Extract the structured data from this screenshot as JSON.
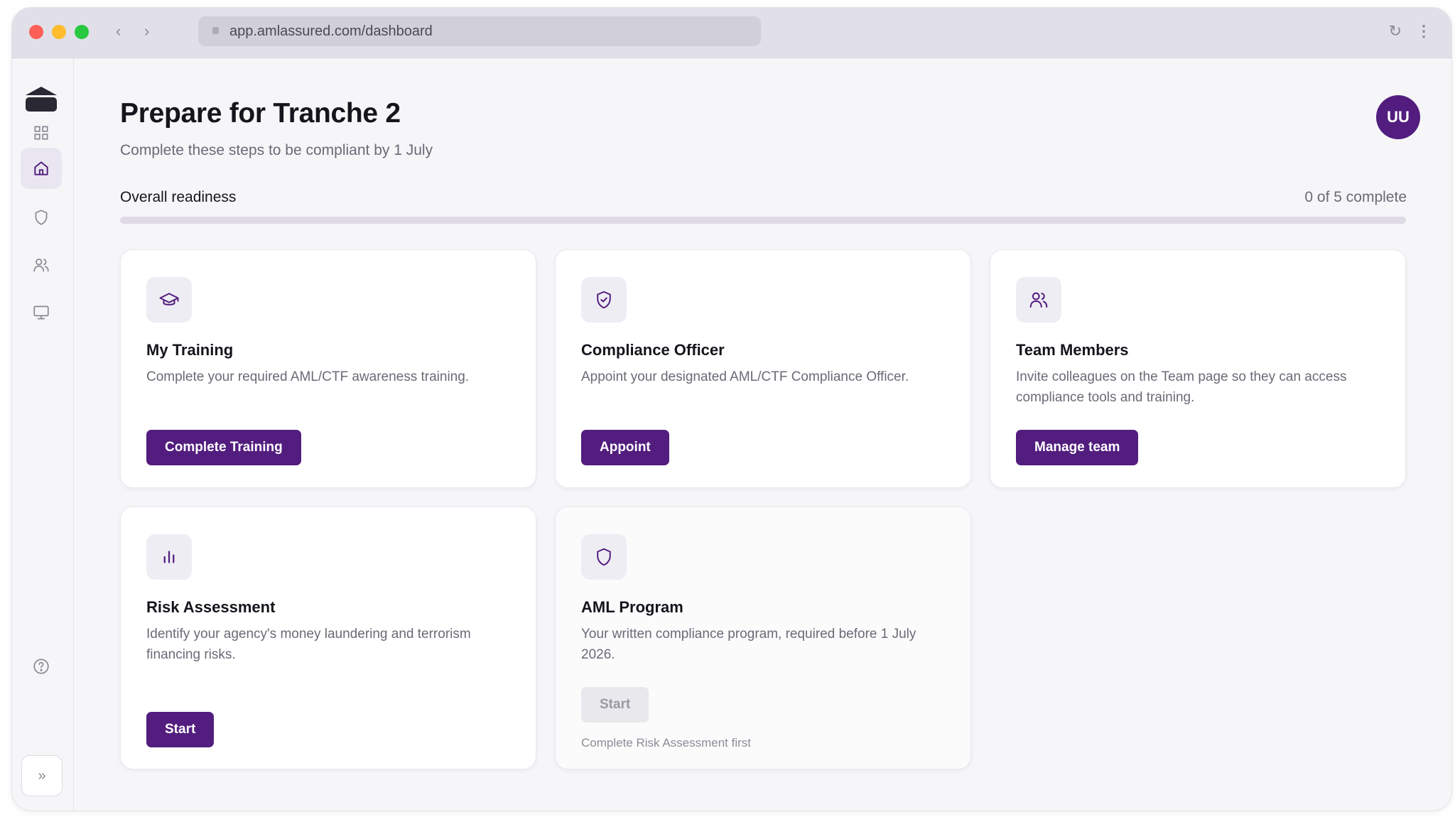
{
  "browser": {
    "url": "app.amlassured.com/dashboard",
    "back_glyph": "‹",
    "forward_glyph": "›",
    "reload_glyph": "↻",
    "more_glyph": "⋮"
  },
  "sidebar": {
    "items": [
      {
        "icon": "grid-icon",
        "active": false
      },
      {
        "icon": "home-icon",
        "active": true
      },
      {
        "icon": "shield-icon",
        "active": false
      },
      {
        "icon": "users-icon",
        "active": false
      },
      {
        "icon": "monitor-icon",
        "active": false
      }
    ],
    "help_icon": "help-circle-icon",
    "expand_glyph": "»"
  },
  "header": {
    "title": "Prepare for Tranche 2",
    "subtitle": "Complete these steps to be compliant by 1 July",
    "avatar_initials": "UU"
  },
  "readiness": {
    "label": "Overall readiness",
    "count_text": "0 of 5 complete",
    "completed": 0,
    "total": 5
  },
  "cards": [
    {
      "icon": "graduation-cap-icon",
      "title": "My Training",
      "description": "Complete your required AML/CTF awareness training.",
      "button": "Complete Training",
      "enabled": true
    },
    {
      "icon": "shield-check-icon",
      "title": "Compliance Officer",
      "description": "Appoint your designated AML/CTF Compliance Officer.",
      "button": "Appoint",
      "enabled": true
    },
    {
      "icon": "users-icon",
      "title": "Team Members",
      "description": "Invite colleagues on the Team page so they can access compliance tools and training.",
      "button": "Manage team",
      "enabled": true
    },
    {
      "icon": "bar-chart-icon",
      "title": "Risk Assessment",
      "description": "Identify your agency's money laundering and terrorism financing risks.",
      "button": "Start",
      "enabled": true
    },
    {
      "icon": "shield-icon",
      "title": "AML Program",
      "description": "Your written compliance program, required before 1 July 2026.",
      "button": "Start",
      "enabled": false,
      "note": "Complete Risk Assessment first"
    }
  ],
  "colors": {
    "accent": "#521d7e",
    "background": "#f6f5f8",
    "muted_text": "#6b6a76"
  }
}
